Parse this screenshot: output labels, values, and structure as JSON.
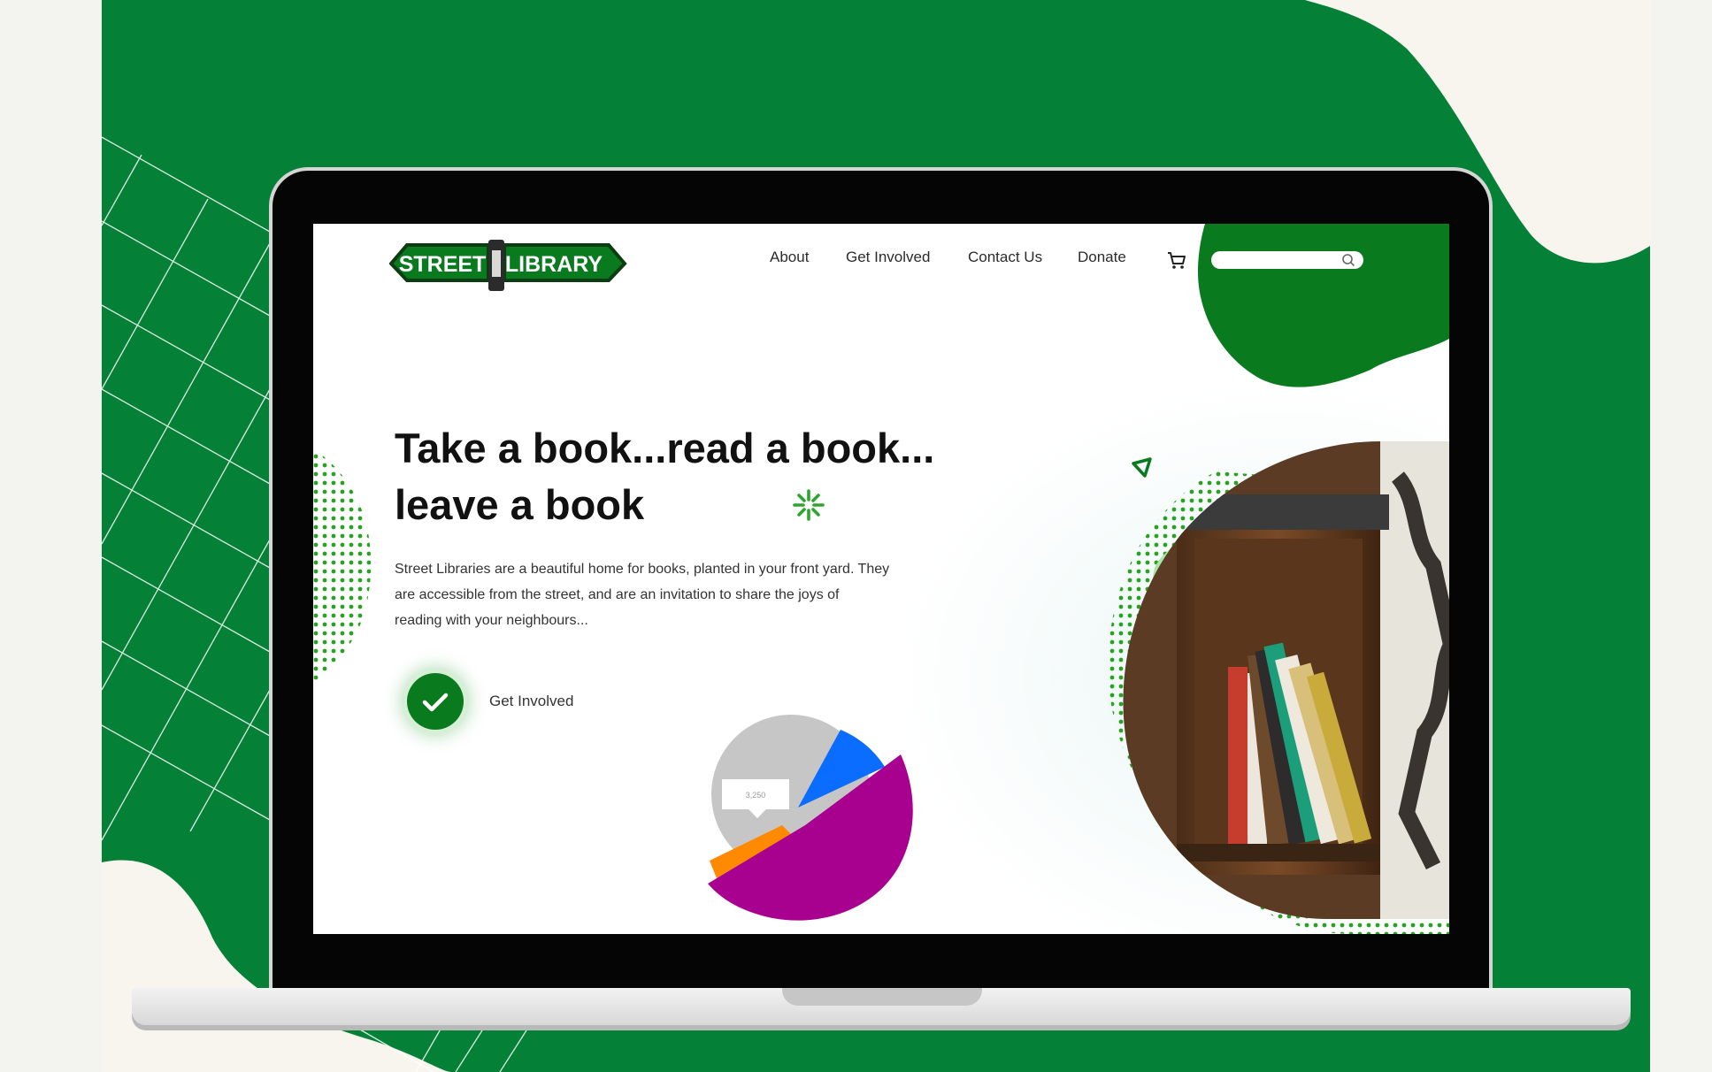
{
  "colors": {
    "brand_green": "#048037",
    "cream": "#f8f4ee",
    "cta_green": "#0a7a1f",
    "light_green": "#a6e6a6",
    "pie_magenta": "#a8008f",
    "pie_blue": "#0a6dff",
    "pie_orange": "#ff8a00",
    "pie_gray": "#c6c6c6"
  },
  "header": {
    "logo": {
      "word_left": "STREET",
      "word_right": "LIBRARY"
    },
    "nav": [
      {
        "label": "About"
      },
      {
        "label": "Get Involved"
      },
      {
        "label": "Contact Us"
      },
      {
        "label": "Donate"
      }
    ],
    "cart_icon": "shopping-cart-icon",
    "search": {
      "placeholder": "",
      "value": "",
      "icon": "search-icon"
    }
  },
  "hero": {
    "title_line1": "Take a book...read a book...",
    "title_line2": "leave a book",
    "description": "Street Libraries are a beautiful home for books, planted in your front yard. They are accessible from the street, and are an invitation to share the joys of reading with your neighbours...",
    "cta": {
      "label": "Get Involved",
      "icon": "checkmark-icon"
    }
  },
  "decor": {
    "pie_tooltip": "3,250",
    "icons": [
      "triangle-icon",
      "sparkle-icon"
    ],
    "image": "street-library-bookshelf-photo"
  }
}
